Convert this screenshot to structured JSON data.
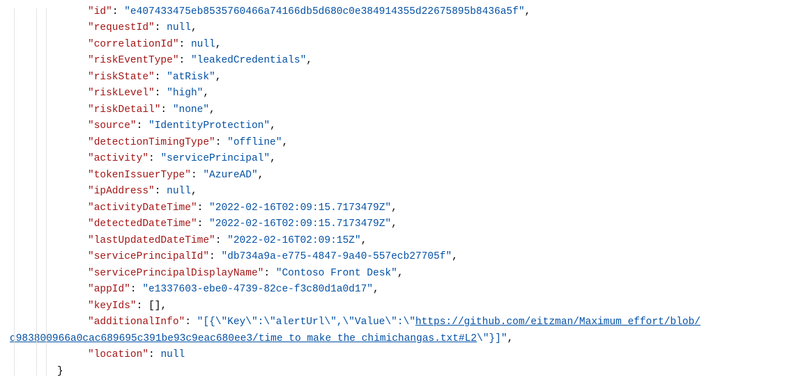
{
  "lines": {
    "id_key": "id",
    "id_val": "e407433475eb8535760466a74166db5d680c0e384914355d22675895b8436a5f",
    "requestId_key": "requestId",
    "requestId_val": "null",
    "correlationId_key": "correlationId",
    "correlationId_val": "null",
    "riskEventType_key": "riskEventType",
    "riskEventType_val": "leakedCredentials",
    "riskState_key": "riskState",
    "riskState_val": "atRisk",
    "riskLevel_key": "riskLevel",
    "riskLevel_val": "high",
    "riskDetail_key": "riskDetail",
    "riskDetail_val": "none",
    "source_key": "source",
    "source_val": "IdentityProtection",
    "detectionTimingType_key": "detectionTimingType",
    "detectionTimingType_val": "offline",
    "activity_key": "activity",
    "activity_val": "servicePrincipal",
    "tokenIssuerType_key": "tokenIssuerType",
    "tokenIssuerType_val": "AzureAD",
    "ipAddress_key": "ipAddress",
    "ipAddress_val": "null",
    "activityDateTime_key": "activityDateTime",
    "activityDateTime_val": "2022-02-16T02:09:15.7173479Z",
    "detectedDateTime_key": "detectedDateTime",
    "detectedDateTime_val": "2022-02-16T02:09:15.7173479Z",
    "lastUpdatedDateTime_key": "lastUpdatedDateTime",
    "lastUpdatedDateTime_val": "2022-02-16T02:09:15Z",
    "servicePrincipalId_key": "servicePrincipalId",
    "servicePrincipalId_val": "db734a9a-e775-4847-9a40-557ecb27705f",
    "servicePrincipalDisplayName_key": "servicePrincipalDisplayName",
    "servicePrincipalDisplayName_val": "Contoso Front Desk",
    "appId_key": "appId",
    "appId_val": "e1337603-ebe0-4739-82ce-f3c80d1a0d17",
    "keyIds_key": "keyIds",
    "keyIds_val": "[]",
    "additionalInfo_key": "additionalInfo",
    "additionalInfo_prefix": "[{\\\"Key\\\":\\\"alertUrl\\\",\\\"Value\\\":\\\"",
    "additionalInfo_url1": "https://github.com/eitzman/Maximum_effort/blob/",
    "additionalInfo_url2": "c983800966a0cac689695c391be93c9eac680ee3/time_to_make_the_chimichangas.txt#L2",
    "additionalInfo_suffix": "\\\"}]",
    "location_key": "location",
    "location_val": "null",
    "close_brace": "}"
  }
}
